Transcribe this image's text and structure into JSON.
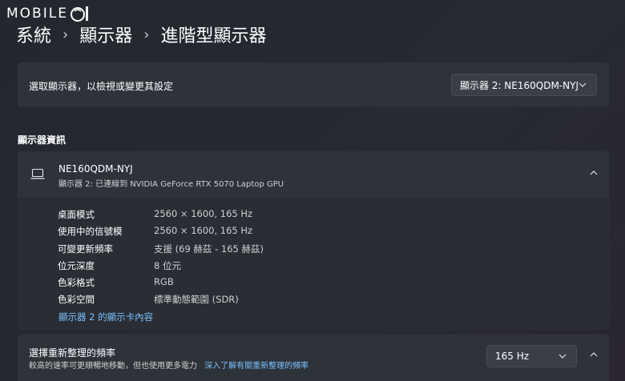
{
  "logo": {
    "text": "MOBILE"
  },
  "breadcrumb": {
    "items": [
      "系統",
      "顯示器",
      "進階型顯示器"
    ],
    "separator": "›"
  },
  "select_display": {
    "label": "選取顯示器，以檢視或變更其設定",
    "value": "顯示器 2: NE160QDM-NYJ"
  },
  "display_info": {
    "section_title": "顯示器資訊",
    "name": "NE160QDM-NYJ",
    "connection": "顯示器 2: 已連線到 NVIDIA GeForce RTX 5070 Laptop GPU",
    "rows": [
      {
        "key": "桌面模式",
        "value": "2560 × 1600, 165 Hz"
      },
      {
        "key": "使用中的信號模",
        "value": "2560 × 1600, 165 Hz"
      },
      {
        "key": "可變更新頻率",
        "value": "支援 (69 赫茲 - 165 赫茲)"
      },
      {
        "key": "位元深度",
        "value": "8 位元"
      },
      {
        "key": "色彩格式",
        "value": "RGB"
      },
      {
        "key": "色彩空間",
        "value": "標準動態範圍 (SDR)"
      }
    ],
    "adapter_link": "顯示器 2 的顯示卡內容"
  },
  "refresh_rate": {
    "title": "選擇重新整理的頻率",
    "description": "較高的速率可更順暢地移動，但也使用更多電力",
    "learn_more": "深入了解有關重新整理的頻率",
    "value": "165 Hz"
  },
  "colors": {
    "background": "#262a31",
    "card": "#2e3239",
    "accent_link": "#79c1ff"
  }
}
